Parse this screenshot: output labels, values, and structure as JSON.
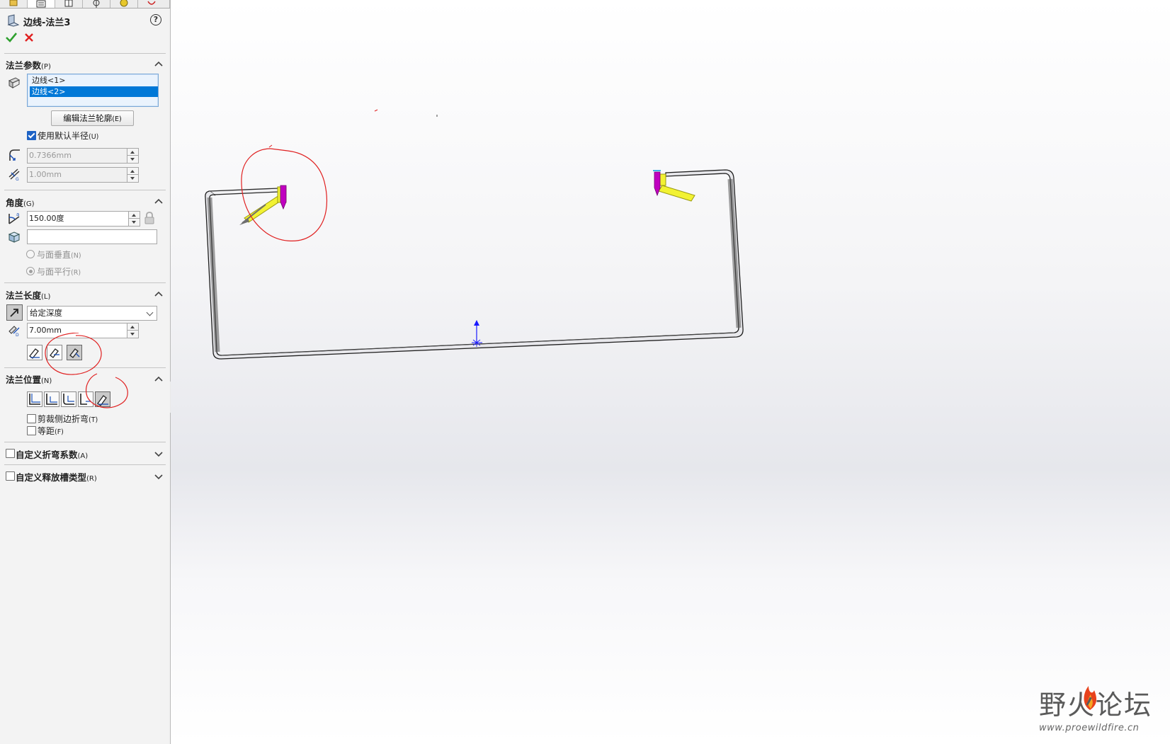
{
  "feature_title": "边线-法兰3",
  "help_label": "?",
  "sections": {
    "flange_params": {
      "title": "法兰参数",
      "hotkey": "(P)",
      "edges": [
        "边线<1>",
        "边线<2>"
      ],
      "edit_profile_button": {
        "label": "编辑法兰轮廓",
        "hotkey": "(E)"
      },
      "use_default_radius": {
        "label": "使用默认半径",
        "hotkey": "(U)",
        "checked": true
      },
      "radius_value": "0.7366mm",
      "gap_value": "1.00mm"
    },
    "angle": {
      "title": "角度",
      "hotkey": "(G)",
      "angle_value": "150.00度",
      "face_value": "",
      "radio_perpendicular": {
        "label": "与面垂直",
        "hotkey": "(N)"
      },
      "radio_parallel": {
        "label": "与面平行",
        "hotkey": "(R)"
      }
    },
    "flange_length": {
      "title": "法兰长度",
      "hotkey": "(L)",
      "end_condition": "给定深度",
      "length_value": "7.00mm"
    },
    "flange_position": {
      "title": "法兰位置",
      "hotkey": "(N)",
      "trim_side_bends": {
        "label": "剪裁侧边折弯",
        "hotkey": "(T)",
        "checked": false
      },
      "offset": {
        "label": "等距",
        "hotkey": "(F)",
        "checked": false
      }
    },
    "custom_bend_allowance": {
      "title": "自定义折弯系数",
      "hotkey": "(A)",
      "checked": false
    },
    "custom_relief_type": {
      "title": "自定义释放槽类型",
      "hotkey": "(R)",
      "checked": false
    }
  },
  "watermark": {
    "text": "野火论坛",
    "url": "www.proewildfire.cn"
  },
  "colors": {
    "accent": "#0078d7",
    "annotation": "#e02020",
    "preview_yellow": "#f2f233",
    "preview_magenta": "#c000c0",
    "triad_blue": "#1a1aff"
  }
}
